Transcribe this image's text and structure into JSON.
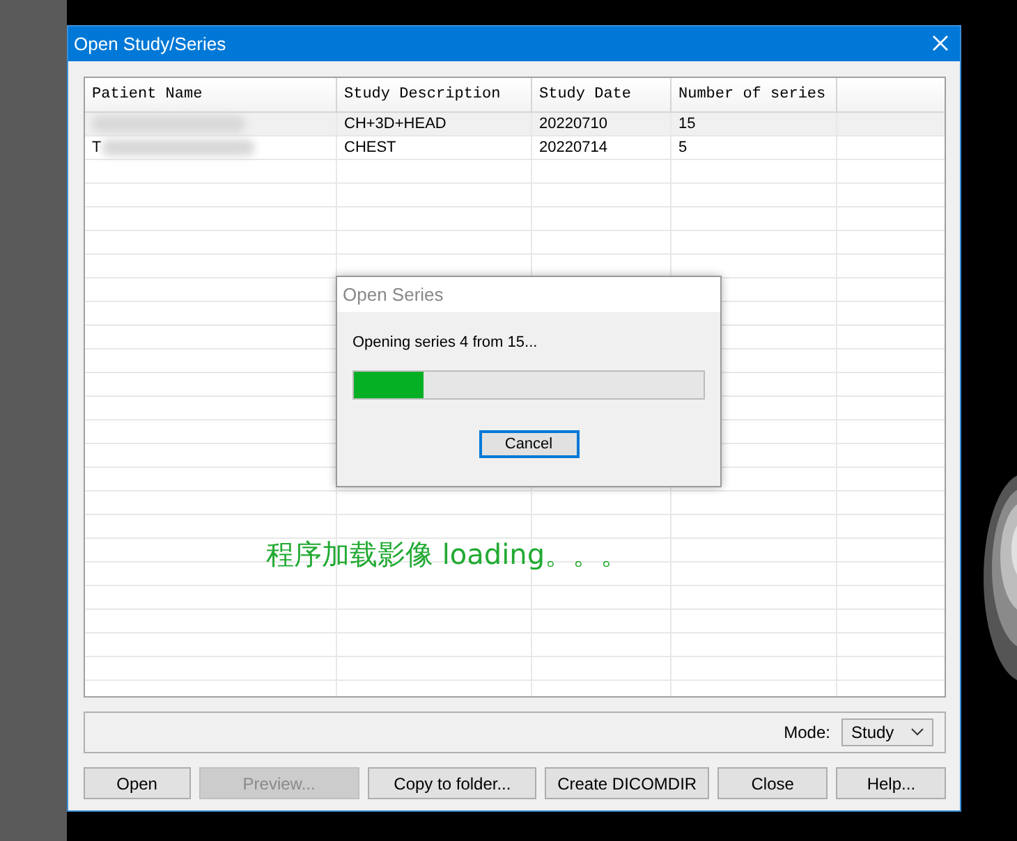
{
  "window": {
    "title": "Open Study/Series"
  },
  "table": {
    "columns": [
      "Patient Name",
      "Study Description",
      "Study Date",
      "Number of series"
    ],
    "rows": [
      {
        "patient_name_redacted": true,
        "study_description": "CH+3D+HEAD",
        "study_date": "20220710",
        "number_of_series": "15",
        "selected": true
      },
      {
        "patient_name": "T",
        "patient_name_redacted": true,
        "study_description": "CHEST",
        "study_date": "20220714",
        "number_of_series": "5",
        "selected": false
      }
    ]
  },
  "progress_dialog": {
    "title": "Open Series",
    "message": "Opening series 4 from 15...",
    "level": 0.2,
    "button": "Cancel"
  },
  "annotation": "程序加载影像 loading。。。",
  "mode": {
    "label": "Mode:",
    "value": "Study"
  },
  "buttons": [
    {
      "label": "Open",
      "disabled": false
    },
    {
      "label": "Preview...",
      "disabled": true
    },
    {
      "label": "Copy to folder...",
      "disabled": false
    },
    {
      "label": "Create DICOMDIR",
      "disabled": false
    },
    {
      "label": "Close",
      "disabled": false
    },
    {
      "label": "Help...",
      "disabled": false
    }
  ]
}
